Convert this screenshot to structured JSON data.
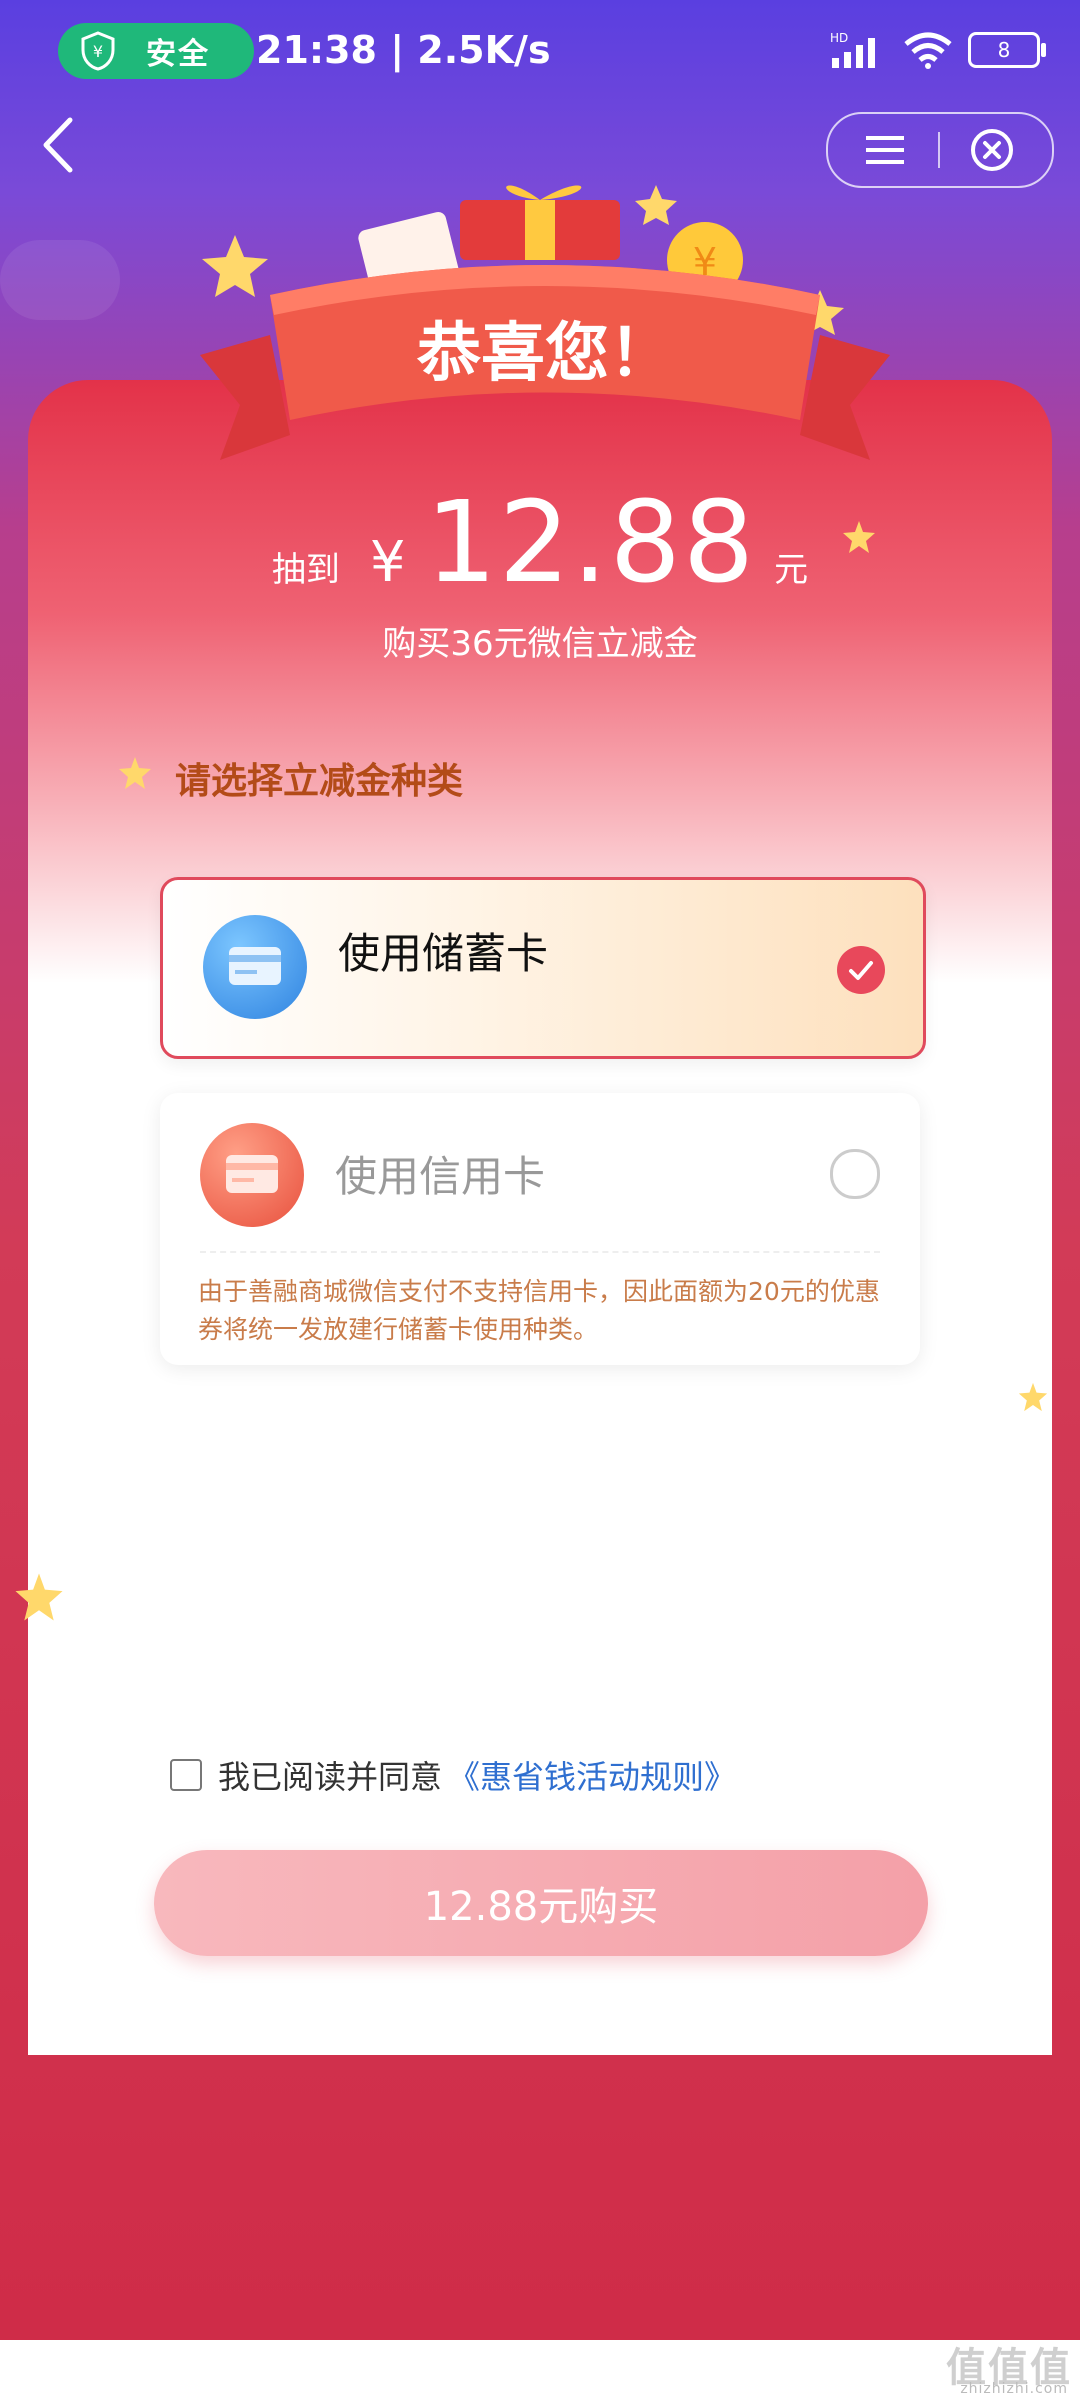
{
  "status_bar": {
    "safe_label": "安全",
    "time_speed": "21:38 | 2.5K/s",
    "network_badge": "HD",
    "battery": "8"
  },
  "banner": {
    "title": "恭喜您！"
  },
  "prize": {
    "label": "抽到",
    "currency": "¥",
    "amount": "12.88",
    "unit": "元",
    "subtitle": "购买36元微信立减金"
  },
  "section": {
    "title": "请选择立减金种类"
  },
  "options": [
    {
      "label": "使用储蓄卡",
      "selected": true
    },
    {
      "label": "使用信用卡",
      "selected": false,
      "note": "由于善融商城微信支付不支持信用卡，因此面额为20元的优惠券将统一发放建行储蓄卡使用种类。"
    }
  ],
  "agreement": {
    "text": "我已阅读并同意",
    "link": "《惠省钱活动规则》",
    "checked": false
  },
  "buy_button": {
    "label": "12.88元购买"
  },
  "watermark": {
    "main": "值值值",
    "sub": "zhizhizhi.com"
  },
  "colors": {
    "accent_red": "#e8485b",
    "link_blue": "#2f6fd0",
    "safe_green": "#1fb87a"
  }
}
